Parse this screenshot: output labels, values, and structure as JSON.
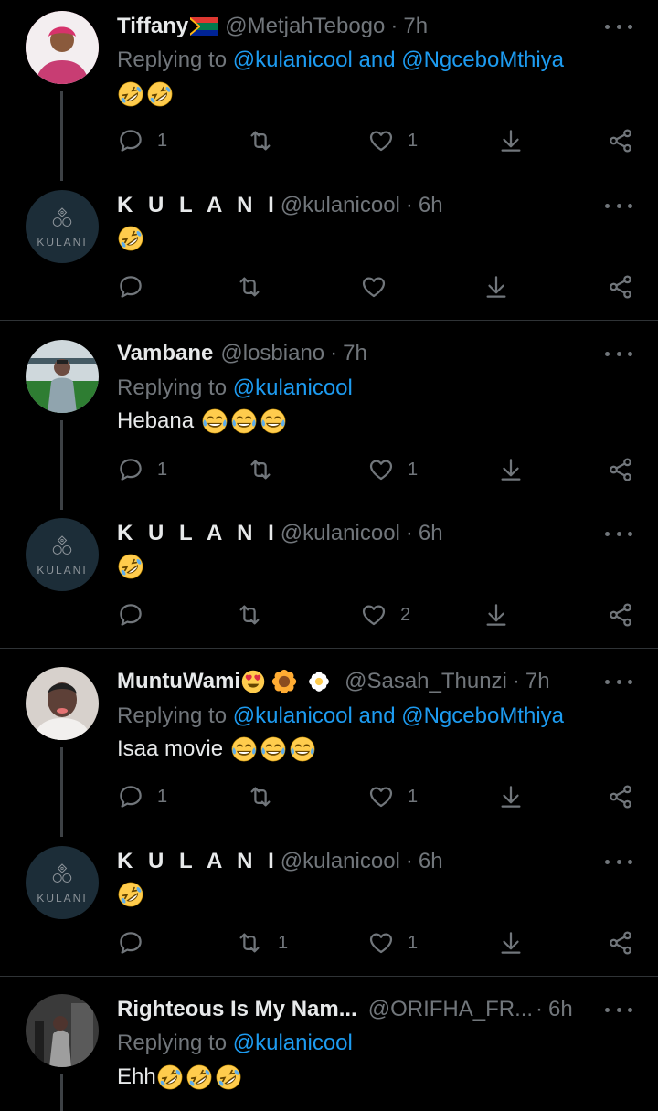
{
  "tweets": [
    {
      "name": "Tiffany",
      "handle": "@MetjahTebogo",
      "time": "7h",
      "reply_prefix": "Replying to ",
      "reply_mentions": "@kulanicool and @NgceboMthiya",
      "text": "",
      "emojis": [
        "rofl",
        "rofl"
      ],
      "reply_count": "1",
      "retweet_count": "",
      "like_count": "1"
    },
    {
      "name": "K U L A N I",
      "handle": "@kulanicool",
      "time": "6h",
      "avatar_text": "KULANI",
      "text": "",
      "emojis": [
        "rofl"
      ],
      "reply_count": "",
      "retweet_count": "",
      "like_count": ""
    },
    {
      "name": "Vambane",
      "handle": "@losbiano",
      "time": "7h",
      "reply_prefix": "Replying to ",
      "reply_mentions": "@kulanicool",
      "text": "Hebana",
      "emojis": [
        "joy",
        "joy",
        "joy"
      ],
      "reply_count": "1",
      "retweet_count": "",
      "like_count": "1"
    },
    {
      "name": "K U L A N I",
      "handle": "@kulanicool",
      "time": "6h",
      "avatar_text": "KULANI",
      "text": "",
      "emojis": [
        "rofl"
      ],
      "reply_count": "",
      "retweet_count": "",
      "like_count": "2"
    },
    {
      "name": "MuntuWami",
      "handle": "@Sasah_Thunzi",
      "time": "7h",
      "reply_prefix": "Replying to ",
      "reply_mentions": "@kulanicool and @NgceboMthiya",
      "text": "Isaa movie",
      "emojis": [
        "joy",
        "joy",
        "joy"
      ],
      "reply_count": "1",
      "retweet_count": "",
      "like_count": "1"
    },
    {
      "name": "K U L A N I",
      "handle": "@kulanicool",
      "time": "6h",
      "avatar_text": "KULANI",
      "text": "",
      "emojis": [
        "rofl"
      ],
      "reply_count": "",
      "retweet_count": "1",
      "like_count": "1"
    },
    {
      "name": "Righteous Is My Nam...",
      "handle": "@ORIFHA_FR...",
      "time": "6h",
      "reply_prefix": "Replying to ",
      "reply_mentions": "@kulanicool",
      "text": "Ehh",
      "emojis": [
        "rofl",
        "rofl",
        "rofl"
      ]
    }
  ],
  "colors": {
    "background": "#000000",
    "primary_text": "#e7e9ea",
    "secondary_text": "#71767b",
    "mention": "#1d9bf0",
    "divider": "#2f3336"
  },
  "icons": [
    "reply-icon",
    "retweet-icon",
    "like-icon",
    "share-icon",
    "more-icon",
    "south-africa-flag-icon",
    "rofl-emoji-icon",
    "joy-emoji-icon",
    "heart-eyes-emoji-icon",
    "sunflower-emoji-icon",
    "blossom-emoji-icon"
  ]
}
